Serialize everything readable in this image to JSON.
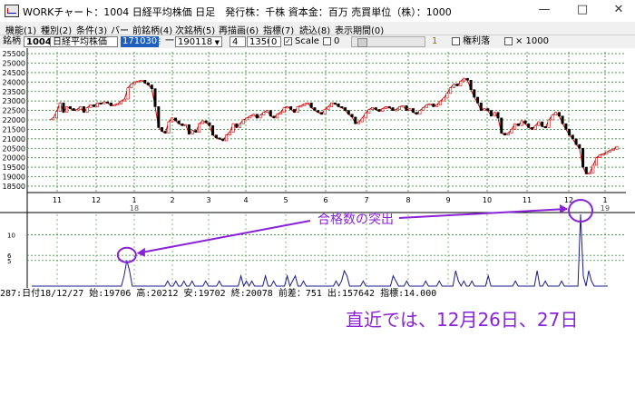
{
  "window": {
    "title": "WORKチャート：1004 日経平均株価 日足　発行株：千株 資本金：百万 売買単位（株）：1000",
    "minimize_icon": "minimize-icon",
    "maximize_icon": "maximize-icon",
    "close_icon": "close-icon"
  },
  "menu": [
    "機能(1)",
    "種別(2)",
    "条件(3)",
    "バー",
    "前銘柄(4)",
    "次銘柄(5)",
    "再描画(6)",
    "指標(7)",
    "読込(8)",
    "表示期間(0)"
  ],
  "toolbar": {
    "code_label": "銘柄",
    "code_value": "1004",
    "name_value": "日経平均株価",
    "start_value": "171030",
    "dash": "一",
    "end_value": "190118",
    "spin_value": "4",
    "width_value": "1350",
    "offset_value": "0",
    "scale_checked": true,
    "scale_label": "Scale",
    "zero_value": "0",
    "number_one": "1",
    "rights_label": "権利落",
    "times_label": "× 1000"
  },
  "status_line": "287:日付18/12/27 始:19706 高:20212 安:19702 終:20078 前差：751 出:157642 指標:14.000",
  "caption": "直近では、12月26日、27日",
  "annotation": "合格数の突出",
  "chart_data": [
    {
      "type": "line",
      "title": "",
      "y_ticks": [
        25500,
        25000,
        24500,
        24000,
        23500,
        23000,
        22500,
        22000,
        21500,
        21000,
        20500,
        20000,
        19500,
        19000,
        18500
      ],
      "ylim": [
        18400,
        25600
      ],
      "x_tick_labels": [
        "11",
        "12",
        "1",
        "2",
        "3",
        "4",
        "5",
        "6",
        "7",
        "8",
        "9",
        "10",
        "11",
        "12",
        "1"
      ],
      "year_labels": [
        "18",
        "19"
      ],
      "grid": true,
      "series": [
        {
          "values": [
            22000,
            22100,
            22450,
            22900,
            22400,
            22700,
            22600,
            22500,
            22550,
            22700,
            22400,
            22650,
            22800,
            22700,
            22900,
            22850,
            22950,
            22900,
            22750,
            22800,
            22850,
            23000,
            23100,
            23700,
            23900,
            24000,
            24050,
            24100,
            23950,
            23850,
            23650,
            22700,
            21600,
            21400,
            21300,
            21900,
            22100,
            21950,
            21800,
            21700,
            21750,
            21250,
            21450,
            21350,
            21800,
            21950,
            21850,
            21700,
            21200,
            21050,
            21000,
            20900,
            21200,
            21350,
            21800,
            21600,
            21800,
            22000,
            22100,
            22200,
            22300,
            22100,
            22250,
            22400,
            22500,
            22200,
            22100,
            22300,
            22400,
            22650,
            22700,
            22550,
            22400,
            22700,
            22750,
            22850,
            22900,
            22650,
            22500,
            22400,
            22300,
            22550,
            22700,
            22900,
            22850,
            22700,
            22650,
            22500,
            22300,
            22150,
            21800,
            21900,
            22100,
            22350,
            22550,
            22650,
            22550,
            22450,
            22600,
            22700,
            22650,
            22500,
            22550,
            22700,
            22750,
            22500,
            22600,
            22400,
            22300,
            22500,
            22650,
            22800,
            22850,
            22700,
            22800,
            23000,
            23150,
            23400,
            23700,
            23900,
            23800,
            24050,
            24200,
            24100,
            23600,
            23200,
            22900,
            22500,
            22600,
            22500,
            22200,
            22400,
            22100,
            21300,
            21200,
            21300,
            21500,
            21800,
            21700,
            21950,
            21800,
            21600,
            21500,
            21700,
            21900,
            21650,
            21600,
            22000,
            22250,
            22400,
            22200,
            21800,
            21500,
            21200,
            21000,
            20700,
            20500,
            19500,
            19150,
            19200,
            19600,
            20000,
            20150,
            20200,
            20300,
            20400,
            20450,
            20600
          ],
          "color": "#cc0000"
        }
      ]
    },
    {
      "type": "line",
      "title": "",
      "y_ticks": [
        10,
        6,
        5
      ],
      "ylim": [
        0,
        14
      ],
      "grid": true,
      "series": [
        {
          "values": [
            0,
            0,
            0,
            0,
            0,
            0,
            0,
            0,
            0,
            0,
            0,
            0,
            0,
            0,
            0,
            0,
            0,
            0,
            0,
            0,
            0,
            0,
            0,
            0,
            0,
            0,
            0,
            0,
            0,
            0,
            0,
            0,
            0,
            0,
            2,
            5,
            3,
            0,
            0,
            0,
            0,
            0,
            0,
            0,
            0,
            0,
            0,
            0,
            0,
            0,
            1,
            0,
            0,
            1,
            0,
            0,
            1,
            0,
            0,
            1,
            0,
            0,
            0,
            0,
            1,
            0,
            0,
            0,
            0,
            1,
            0,
            0,
            0,
            0,
            0,
            0,
            0,
            2,
            0,
            1,
            0,
            1,
            0,
            0,
            0,
            0,
            2,
            0,
            0,
            1,
            0,
            0,
            0,
            0,
            2,
            0,
            1,
            2,
            0,
            0,
            1,
            0,
            0,
            0,
            0,
            0,
            0,
            0,
            0,
            0,
            0,
            0,
            1,
            0,
            1,
            3,
            2,
            0,
            0,
            0,
            0,
            0,
            1,
            0,
            0,
            0,
            0,
            0,
            0,
            0,
            0,
            0,
            0,
            2,
            1,
            0,
            0,
            0,
            1,
            0,
            0,
            0,
            0,
            0,
            0,
            1,
            0,
            0,
            0,
            0,
            1,
            0,
            0,
            0,
            0,
            0,
            3,
            1,
            0,
            1,
            0,
            0,
            1,
            0,
            0,
            0,
            0,
            0,
            2,
            0,
            0,
            0,
            0,
            0,
            0,
            0,
            0,
            0,
            1,
            0,
            0,
            0,
            0,
            0,
            0,
            0,
            3,
            0,
            0,
            1,
            0,
            0,
            0,
            0,
            0,
            1,
            0,
            0,
            0,
            0,
            0,
            0,
            14,
            2,
            0,
            3,
            1,
            0,
            0,
            0,
            0,
            0,
            0
          ],
          "color": "#1a1a8c"
        }
      ]
    }
  ]
}
